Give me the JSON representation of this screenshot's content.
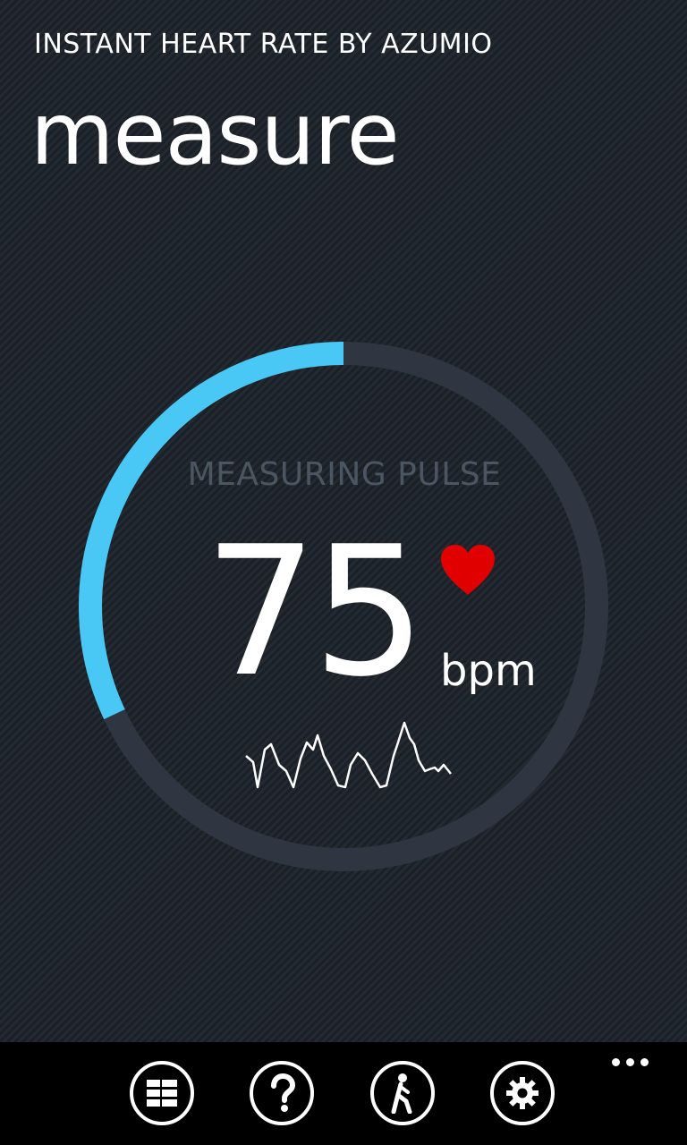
{
  "header": {
    "app_title": "INSTANT HEART RATE BY AZUMIO",
    "page_title": "measure"
  },
  "measurement": {
    "status": "MEASURING PULSE",
    "bpm": "75",
    "unit": "bpm",
    "progress": 0.32
  },
  "colors": {
    "accent": "#4ac8f5",
    "track": "#2f3641",
    "heart": "#e00000",
    "status_text": "#4b5662"
  },
  "app_bar": {
    "buttons": [
      {
        "name": "history",
        "icon": "list-icon"
      },
      {
        "name": "help",
        "icon": "question-icon"
      },
      {
        "name": "activity",
        "icon": "walking-person-icon"
      },
      {
        "name": "settings",
        "icon": "gear-icon"
      }
    ],
    "more_icon": "ellipsis-icon"
  }
}
